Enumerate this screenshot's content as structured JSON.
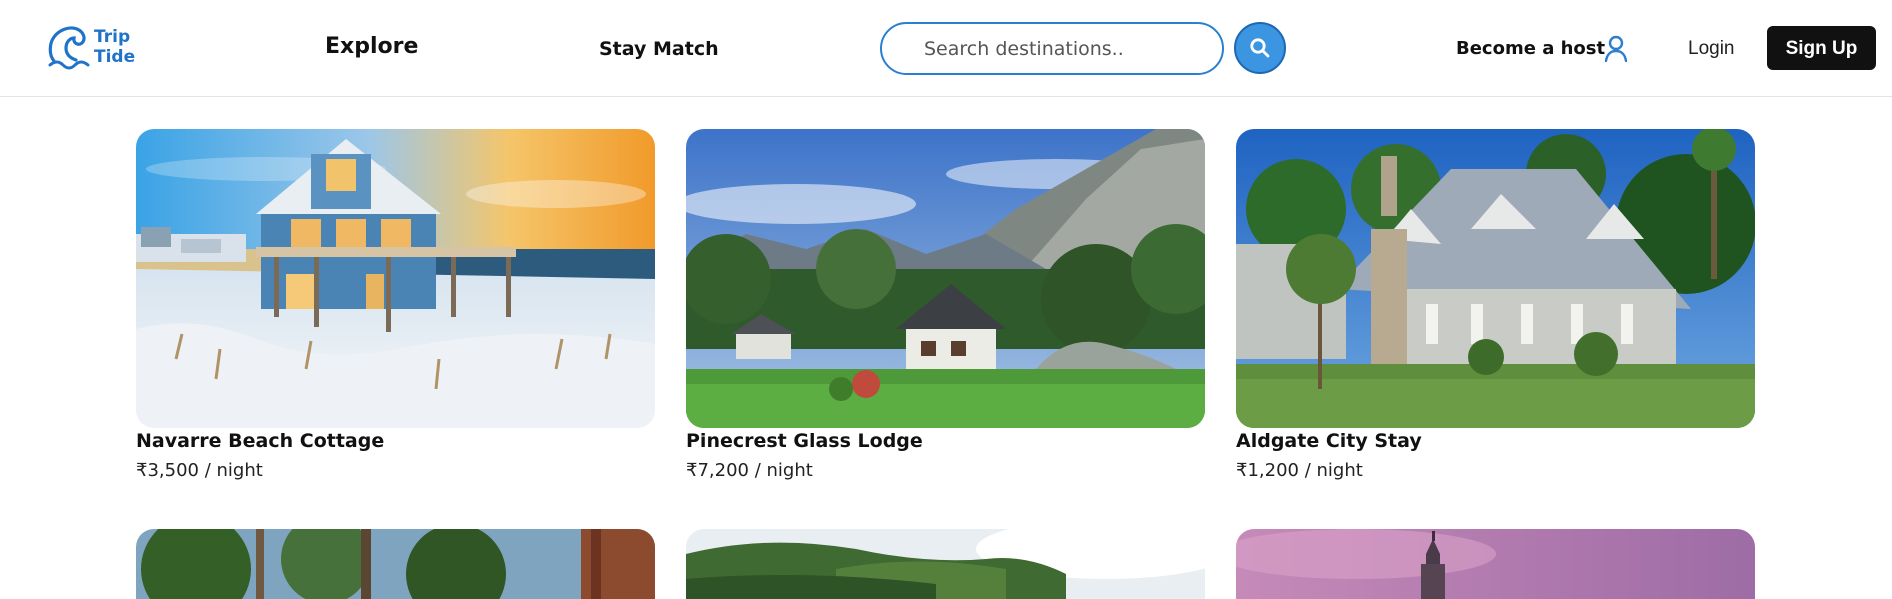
{
  "brand": {
    "line1": "Trip",
    "line2": "Tide",
    "color": "#1f73c8",
    "icon": "wave-logo-icon"
  },
  "nav": {
    "explore": "Explore",
    "stay_match": "Stay Match"
  },
  "search": {
    "placeholder": "Search destinations..",
    "button_icon": "search-icon",
    "accent": "#3b95e0"
  },
  "auth": {
    "become_host": "Become a host",
    "host_icon": "user-icon",
    "login": "Login",
    "signup": "Sign Up"
  },
  "listings": [
    {
      "title": "Navarre Beach Cottage",
      "price": "₹3,500 / night",
      "image": "beach-house-image"
    },
    {
      "title": "Pinecrest Glass Lodge",
      "price": "₹7,200 / night",
      "image": "mountain-lodge-image"
    },
    {
      "title": "Aldgate City Stay",
      "price": "₹1,200 / night",
      "image": "city-house-image"
    },
    {
      "image": "forest-image"
    },
    {
      "image": "lake-image"
    },
    {
      "image": "castle-image"
    }
  ]
}
